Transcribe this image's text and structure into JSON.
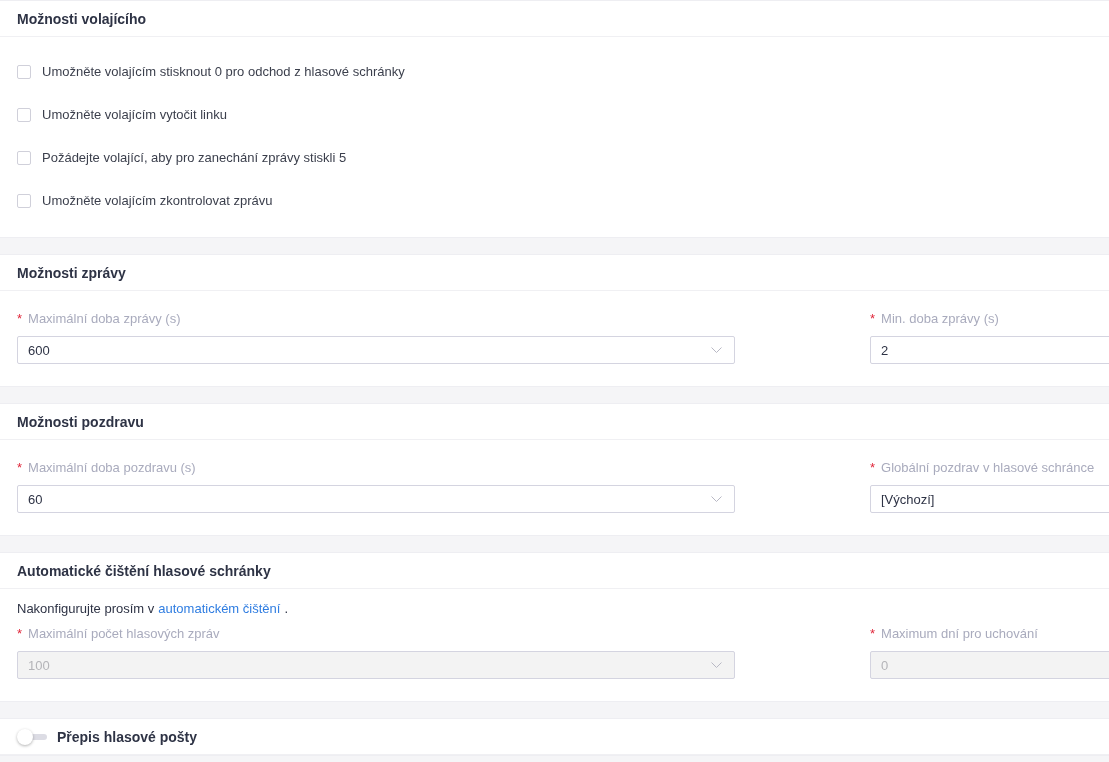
{
  "caller_options": {
    "title": "Možnosti volajícího",
    "checkboxes": [
      {
        "label": "Umožněte volajícím stisknout 0 pro odchod z hlasové schránky",
        "checked": false
      },
      {
        "label": "Umožněte volajícím vytočit linku",
        "checked": false
      },
      {
        "label": "Požádejte volající, aby pro zanechání zprávy stiskli 5",
        "checked": false
      },
      {
        "label": "Umožněte volajícím zkontrolovat zprávu",
        "checked": false
      }
    ]
  },
  "message_options": {
    "title": "Možnosti zprávy",
    "fields": [
      {
        "kind": "select",
        "required_mark": "*",
        "label": "Maximální doba zprávy (s)",
        "value": "600",
        "disabled": false
      },
      {
        "kind": "input",
        "required_mark": "*",
        "label": "Min. doba zprávy (s)",
        "value": "2",
        "disabled": false
      }
    ]
  },
  "greeting_options": {
    "title": "Možnosti pozdravu",
    "fields": [
      {
        "kind": "select",
        "required_mark": "*",
        "label": "Maximální doba pozdravu (s)",
        "value": "60",
        "disabled": false
      },
      {
        "kind": "input",
        "required_mark": "*",
        "label": "Globální pozdrav v hlasové schránce",
        "value": "[Výchozí]",
        "disabled": false
      }
    ]
  },
  "auto_cleanup": {
    "title": "Automatické čištění hlasové schránky",
    "note": "Nakonfigurujte prosím v",
    "link": "automatickém čištění",
    "note_end": ".",
    "fields": [
      {
        "kind": "select",
        "required_mark": "*",
        "label": "Maximální počet hlasových zpráv",
        "value": "100",
        "disabled": true
      },
      {
        "kind": "input",
        "required_mark": "*",
        "label": "Maximum dní pro uchování",
        "value": "0",
        "disabled": true
      }
    ]
  },
  "transcription": {
    "title": "Přepis hlasové pošty",
    "on": false
  }
}
